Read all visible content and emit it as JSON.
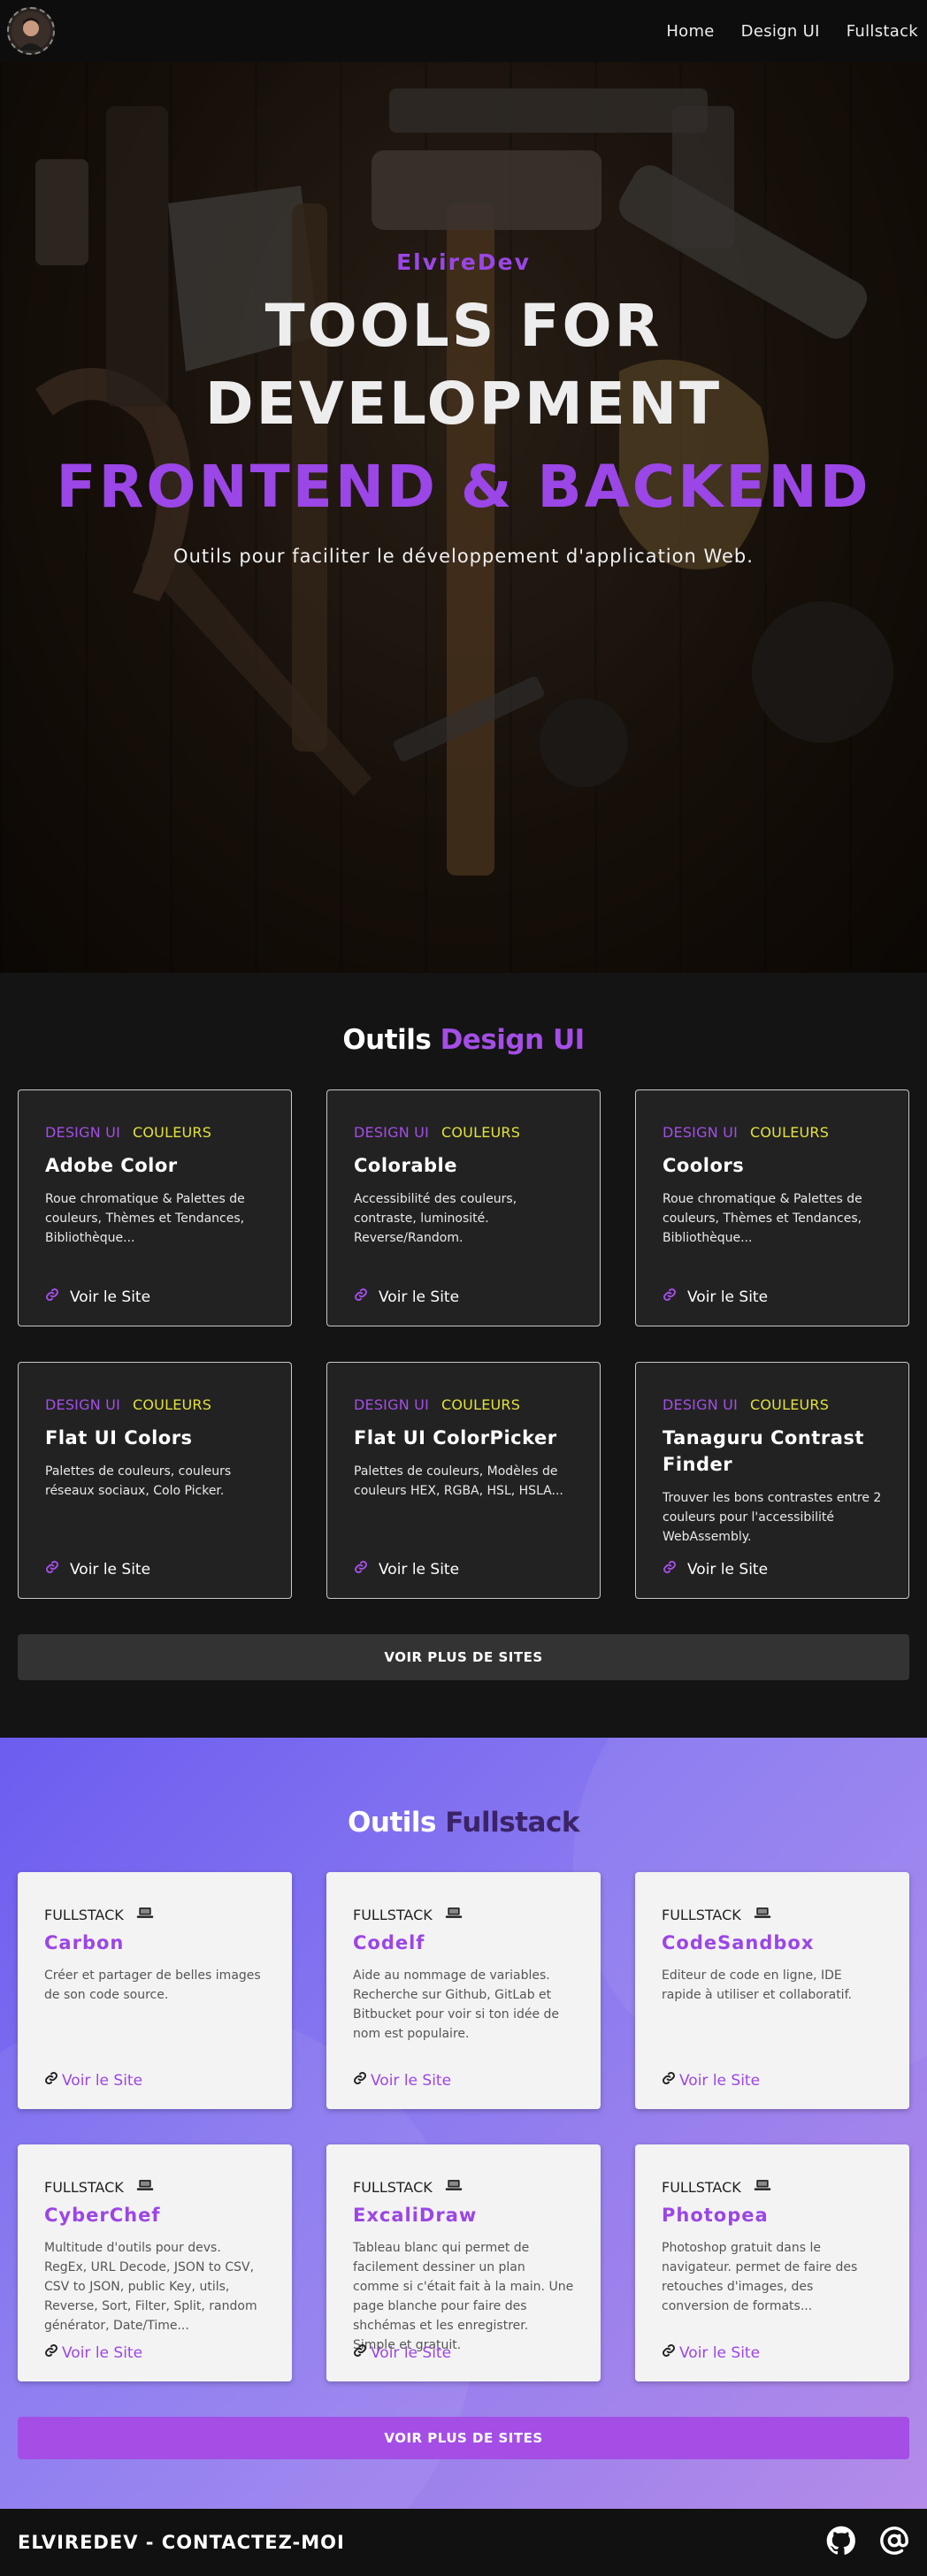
{
  "nav": {
    "links": [
      "Home",
      "Design UI",
      "Fullstack"
    ]
  },
  "hero": {
    "brand": "ElvireDev",
    "title_line1": "TOOLS FOR",
    "title_line2": "DEVELOPMENT",
    "title_line3": "FRONTEND & BACKEND",
    "subtitle": "Outils pour faciliter le développement d'application Web."
  },
  "design": {
    "title_plain": "Outils",
    "title_accent": "Design UI",
    "tag_a": "DESIGN UI",
    "tag_b": "COULEURS",
    "link_label": "Voir le Site",
    "cards": [
      {
        "title": "Adobe Color",
        "desc": "Roue chromatique & Palettes de couleurs, Thèmes et Tendances, Bibliothèque..."
      },
      {
        "title": "Colorable",
        "desc": "Accessibilité des couleurs, contraste, luminosité. Reverse/Random."
      },
      {
        "title": "Coolors",
        "desc": "Roue chromatique & Palettes de couleurs, Thèmes et Tendances, Bibliothèque..."
      },
      {
        "title": "Flat UI Colors",
        "desc": "Palettes de couleurs, couleurs réseaux sociaux, Colo Picker."
      },
      {
        "title": "Flat UI ColorPicker",
        "desc": "Palettes de couleurs, Modèles de couleurs HEX, RGBA, HSL, HSLA..."
      },
      {
        "title": "Tanaguru Contrast Finder",
        "desc": "Trouver les bons contrastes entre 2 couleurs pour l'accessibilité WebAssembly."
      }
    ],
    "more_label": "VOIR PLUS DE SITES"
  },
  "fullstack": {
    "title_plain": "Outils",
    "title_dark": "Fullstack",
    "tag": "FULLSTACK",
    "link_label": "Voir le Site",
    "cards": [
      {
        "title": "Carbon",
        "desc": "Créer et partager de belles images de son code source."
      },
      {
        "title": "Codelf",
        "desc": "Aide au nommage de variables. Recherche sur Github, GitLab et Bitbucket pour voir si ton idée de nom est populaire."
      },
      {
        "title": "CodeSandbox",
        "desc": "Editeur de code en ligne, IDE rapide à utiliser et collaboratif."
      },
      {
        "title": "CyberChef",
        "desc": "Multitude d'outils pour devs. RegEx, URL Decode, JSON to CSV, CSV to JSON, public Key, utils, Reverse, Sort, Filter, Split, random générator, Date/Time..."
      },
      {
        "title": "ExcaliDraw",
        "desc": "Tableau blanc qui permet de facilement dessiner un plan comme si c'était fait à la main. Une page blanche pour faire des shchémas et les enregistrer. Simple et gratuit."
      },
      {
        "title": "Photopea",
        "desc": "Photoshop gratuit dans le navigateur. permet de faire des retouches d'images, des conversion de formats..."
      }
    ],
    "more_label": "VOIR PLUS DE SITES"
  },
  "footer": {
    "text": "ELVIREDEV - CONTACTEZ-MOI"
  },
  "colors": {
    "accent_purple": "#9b46e6",
    "tag_yellow": "#e3e13c",
    "dark_bg": "#141414",
    "card_bg": "#222222"
  },
  "icons": {
    "link": "link-icon",
    "laptop": "laptop-icon",
    "github": "github-icon",
    "email": "at-sign-icon"
  }
}
